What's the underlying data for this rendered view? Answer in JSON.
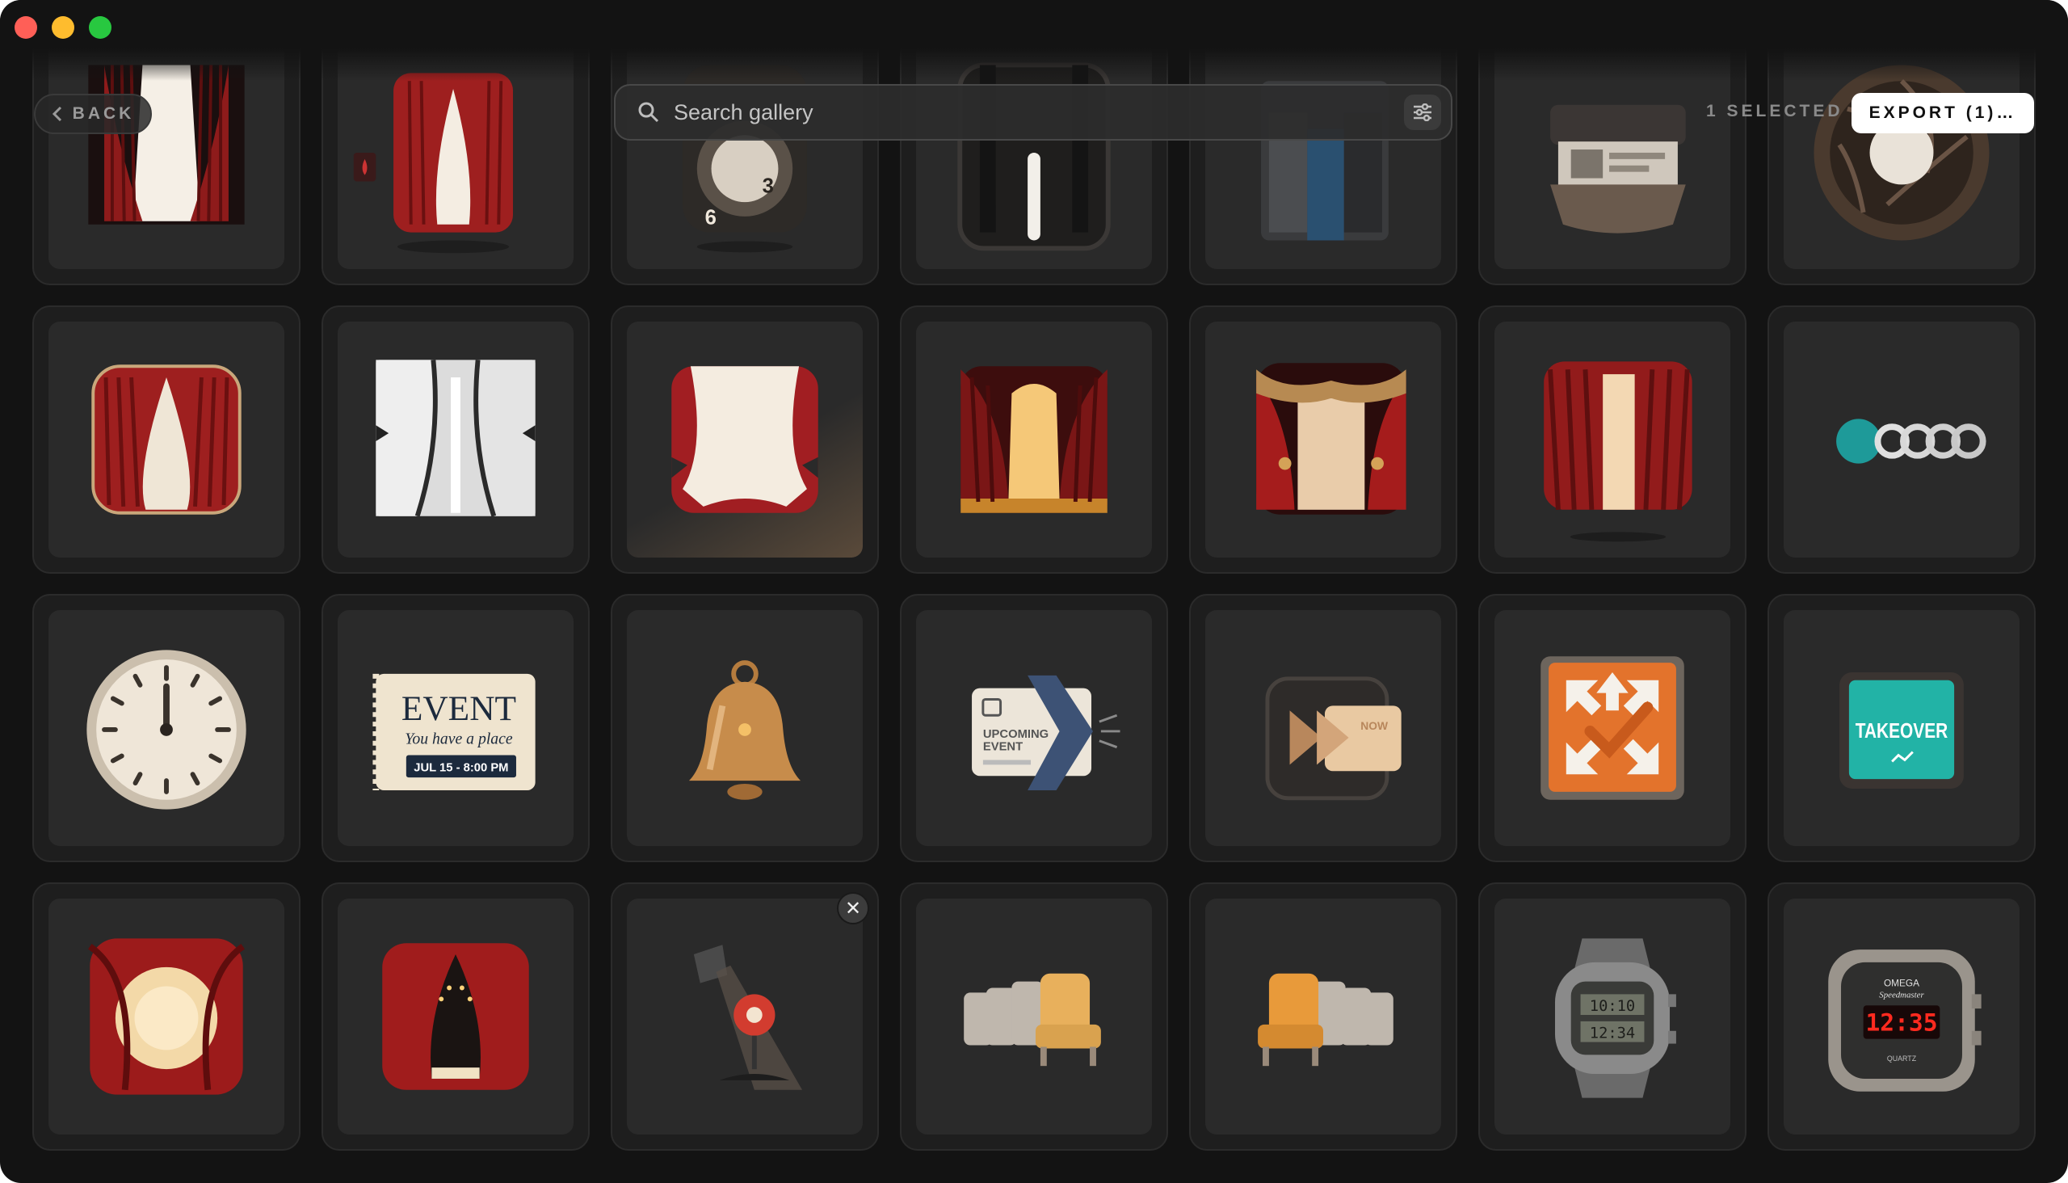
{
  "window": {
    "traffic_lights": [
      {
        "name": "close",
        "color": "#ff5f57"
      },
      {
        "name": "minimize",
        "color": "#febc2e"
      },
      {
        "name": "zoom",
        "color": "#28c840"
      }
    ]
  },
  "toolbar": {
    "back_label": "BACK",
    "search_placeholder": "Search gallery",
    "selected_count": "1 SELECTED",
    "export_label": "EXPORT (1)…"
  },
  "colors": {
    "background": "#131313",
    "tile": "#1e1e1e",
    "tile_inner": "#2a2a2a",
    "curtain_red": "#9e1f1f",
    "gold": "#c68a45"
  },
  "gallery": {
    "rows": [
      [
        {
          "icon": "theater-curtain-spotlight-icon"
        },
        {
          "icon": "theater-curtain-with-thumbnail-icon"
        },
        {
          "icon": "dial-gauge-icon"
        },
        {
          "icon": "dark-door-light-slit-icon"
        },
        {
          "icon": "dark-box-icon"
        },
        {
          "icon": "kiosk-box-icon"
        },
        {
          "icon": "camera-aperture-icon"
        }
      ],
      [
        {
          "icon": "red-curtain-app-icon"
        },
        {
          "icon": "white-curtain-panels-icon"
        },
        {
          "icon": "red-curtain-flat-icon",
          "selected": true
        },
        {
          "icon": "stage-curtain-glow-icon"
        },
        {
          "icon": "stage-curtain-gold-trim-icon"
        },
        {
          "icon": "stage-curtain-light-beam-icon"
        },
        {
          "icon": "progress-dots-icon"
        }
      ],
      [
        {
          "icon": "wall-clock-icon"
        },
        {
          "icon": "event-ticket-icon",
          "texts": {
            "title": "EVENT",
            "subtitle": "You have a place",
            "date": "JUL 15 - 8:00 PM"
          }
        },
        {
          "icon": "bell-icon"
        },
        {
          "icon": "upcoming-event-card-icon",
          "texts": {
            "line1": "UPCOMING",
            "line2": "EVENT"
          }
        },
        {
          "icon": "fast-forward-card-icon",
          "texts": {
            "badge": "NOW"
          }
        },
        {
          "icon": "converge-arrows-check-icon"
        },
        {
          "icon": "takeover-sign-icon",
          "texts": {
            "label": "TAKEOVER"
          }
        }
      ],
      [
        {
          "icon": "curtain-glow-circle-icon"
        },
        {
          "icon": "curtain-stage-lights-icon"
        },
        {
          "icon": "spotlight-location-pin-icon",
          "removable": true
        },
        {
          "icon": "theater-seats-right-icon"
        },
        {
          "icon": "theater-seats-left-icon"
        },
        {
          "icon": "digital-wristwatch-icon",
          "texts": {
            "time_top": "10:10",
            "time_bottom": "12:34"
          }
        },
        {
          "icon": "omega-speedmaster-watch-icon",
          "texts": {
            "brand": "OMEGA",
            "model": "Speedmaster",
            "time": "12:35",
            "movement": "QUARTZ"
          }
        }
      ]
    ]
  }
}
